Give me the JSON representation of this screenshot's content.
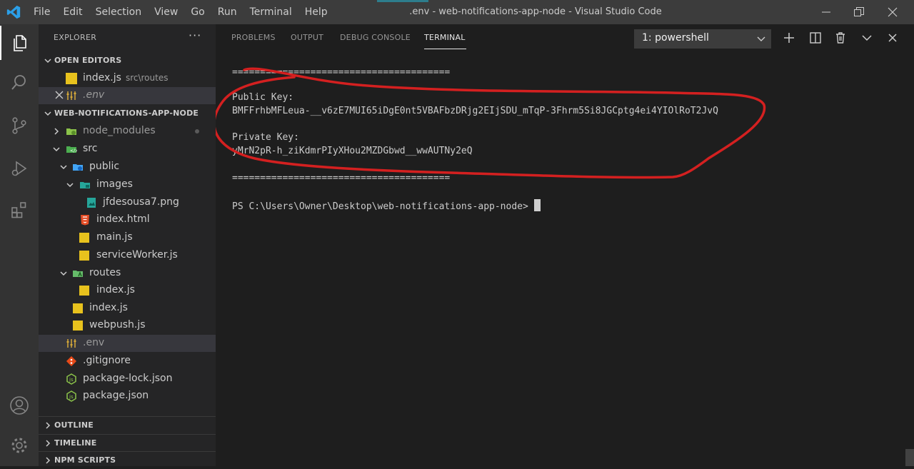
{
  "menu": [
    "File",
    "Edit",
    "Selection",
    "View",
    "Go",
    "Run",
    "Terminal",
    "Help"
  ],
  "window_title": ".env - web-notifications-app-node - Visual Studio Code",
  "sidebar": {
    "title": "EXPLORER",
    "more": "···",
    "open_editors": {
      "label": "OPEN EDITORS",
      "items": [
        {
          "name": "index.js",
          "desc": "src\\routes"
        },
        {
          "name": ".env"
        }
      ]
    },
    "project": {
      "label": "WEB-NOTIFICATIONS-APP-NODE",
      "items": [
        "node_modules",
        "src",
        "public",
        "images",
        "jfdesousa7.png",
        "index.html",
        "main.js",
        "serviceWorker.js",
        "routes",
        "index.js",
        "index.js",
        "webpush.js",
        ".env",
        ".gitignore",
        "package-lock.json",
        "package.json"
      ]
    },
    "sections": [
      "OUTLINE",
      "TIMELINE",
      "NPM SCRIPTS"
    ]
  },
  "panel": {
    "tabs": [
      "PROBLEMS",
      "OUTPUT",
      "DEBUG CONSOLE",
      "TERMINAL"
    ],
    "active_tab": "TERMINAL",
    "shell": "1: powershell"
  },
  "terminal": {
    "separator_top": "=======================================",
    "public_key_label": "Public Key:",
    "public_key": "BMFFrhbMFLeua-__v6zE7MUI65iDgE0nt5VBAFbzDRjg2EIjSDU_mTqP-3Fhrm5Si8JGCptg4ei4YIOlRoT2JvQ",
    "private_key_label": "Private Key:",
    "private_key": "yMrN2pR-h_ziKdmrPIyXHou2MZDGbwd__wwAUTNy2eQ",
    "separator_bottom": "=======================================",
    "prompt": "PS C:\\Users\\Owner\\Desktop\\web-notifications-app-node>"
  },
  "colors": {
    "annotation": "#d42020",
    "js_icon": "#e8c21d",
    "selection": "#37373d"
  }
}
